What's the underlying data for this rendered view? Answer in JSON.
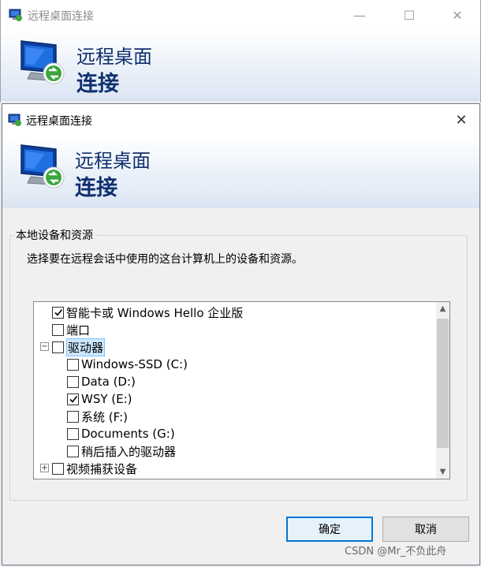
{
  "back_window": {
    "title": "远程桌面连接",
    "minimize_glyph": "—",
    "maximize_glyph": "☐",
    "close_glyph": "✕",
    "banner_line1": "远程桌面",
    "banner_line2": "连接"
  },
  "dialog": {
    "title": "远程桌面连接",
    "close_glyph": "✕",
    "banner_line1": "远程桌面",
    "banner_line2": "连接",
    "group_title": "本地设备和资源",
    "description": "选择要在远程会话中使用的这台计算机上的设备和资源。",
    "tree": [
      {
        "label": "智能卡或 Windows Hello 企业版",
        "checked": true
      },
      {
        "label": "端口",
        "checked": false
      },
      {
        "label": "驱动器",
        "checked": false,
        "expander": "−"
      },
      {
        "label": "Windows-SSD (C:)",
        "checked": false
      },
      {
        "label": "Data (D:)",
        "checked": false
      },
      {
        "label": "WSY (E:)",
        "checked": true
      },
      {
        "label": "系统 (F:)",
        "checked": false
      },
      {
        "label": "Documents (G:)",
        "checked": false
      },
      {
        "label": "稍后插入的驱动器",
        "checked": false
      },
      {
        "label": "视频捕获设备",
        "checked": false,
        "expander": "+"
      }
    ],
    "ok_label": "确定",
    "cancel_label": "取消"
  },
  "watermark": "CSDN @Mr_不负此舟",
  "colors": {
    "accent": "#0078d7",
    "banner_text": "#10306e",
    "selection": "#cce8ff"
  }
}
